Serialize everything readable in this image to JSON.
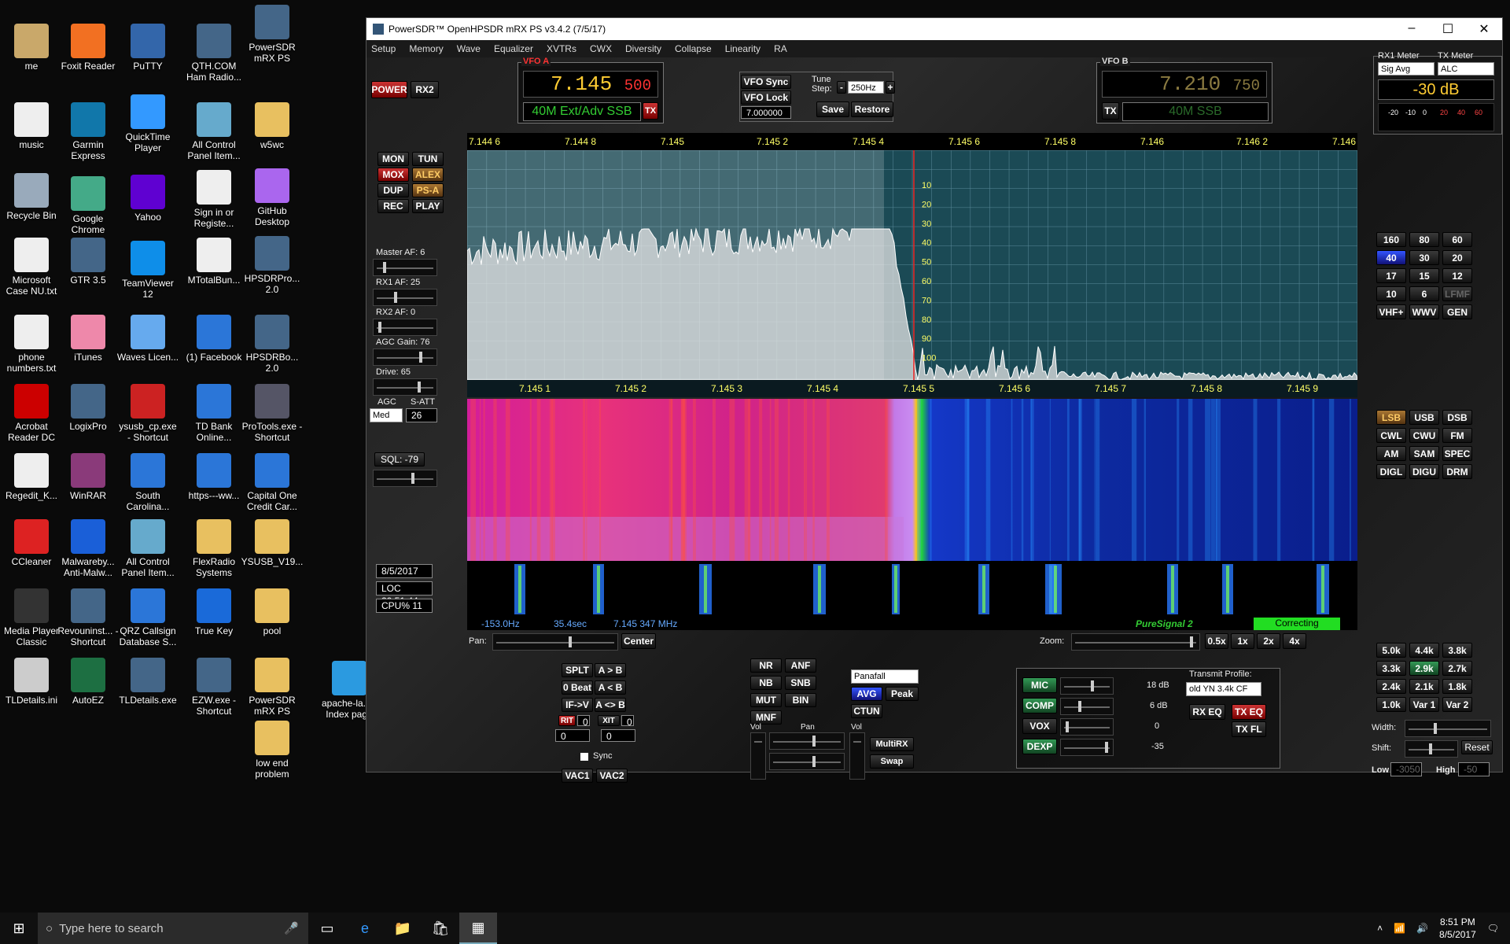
{
  "desktop": {
    "icons": [
      {
        "label": "me",
        "icon": "folder-user-icon"
      },
      {
        "label": "Foxit Reader",
        "icon": "pdf-icon"
      },
      {
        "label": "PuTTY",
        "icon": "terminal-icon"
      },
      {
        "label": "QTH.COM Ham Radio...",
        "icon": "app-icon"
      },
      {
        "label": "PowerSDR mRX PS",
        "icon": "app-icon"
      },
      {
        "label": "music",
        "icon": "file-icon"
      },
      {
        "label": "Garmin Express",
        "icon": "globe-icon"
      },
      {
        "label": "QuickTime Player",
        "icon": "quicktime-icon"
      },
      {
        "label": "All Control Panel Item...",
        "icon": "control-panel-icon"
      },
      {
        "label": "w5wc",
        "icon": "folder-icon"
      },
      {
        "label": "Recycle Bin",
        "icon": "recycle-bin-icon"
      },
      {
        "label": "Google Chrome",
        "icon": "chrome-icon"
      },
      {
        "label": "Yahoo",
        "icon": "yahoo-icon"
      },
      {
        "label": "Sign in or Registe...",
        "icon": "file-icon"
      },
      {
        "label": "GitHub Desktop",
        "icon": "github-icon"
      },
      {
        "label": "Microsoft Case NU.txt",
        "icon": "text-file-icon"
      },
      {
        "label": "GTR 3.5",
        "icon": "app-icon"
      },
      {
        "label": "TeamViewer 12",
        "icon": "teamviewer-icon"
      },
      {
        "label": "MTotalBun...",
        "icon": "file-icon"
      },
      {
        "label": "HPSDRPro... 2.0",
        "icon": "app-icon"
      },
      {
        "label": "phone numbers.txt",
        "icon": "text-file-icon"
      },
      {
        "label": "iTunes",
        "icon": "itunes-icon"
      },
      {
        "label": "Waves Licen...",
        "icon": "waves-icon"
      },
      {
        "label": "(1) Facebook",
        "icon": "edge-icon"
      },
      {
        "label": "HPSDRBo... 2.0",
        "icon": "app-icon"
      },
      {
        "label": "Acrobat Reader DC",
        "icon": "acrobat-icon"
      },
      {
        "label": "LogixPro",
        "icon": "app-icon"
      },
      {
        "label": "ysusb_cp.exe - Shortcut",
        "icon": "usb-icon"
      },
      {
        "label": "TD Bank Online...",
        "icon": "edge-icon"
      },
      {
        "label": "ProTools.exe - Shortcut",
        "icon": "protools-icon"
      },
      {
        "label": "Regedit_K...",
        "icon": "file-icon"
      },
      {
        "label": "WinRAR",
        "icon": "winrar-icon"
      },
      {
        "label": "South Carolina...",
        "icon": "edge-icon"
      },
      {
        "label": "https---ww...",
        "icon": "edge-icon"
      },
      {
        "label": "Capital One Credit Car...",
        "icon": "edge-icon"
      },
      {
        "label": "CCleaner",
        "icon": "ccleaner-icon"
      },
      {
        "label": "Malwareby... Anti-Malw...",
        "icon": "malwarebytes-icon"
      },
      {
        "label": "All Control Panel Item...",
        "icon": "control-panel-icon"
      },
      {
        "label": "FlexRadio Systems",
        "icon": "folder-icon"
      },
      {
        "label": "YSUSB_V19...",
        "icon": "folder-icon"
      },
      {
        "label": "Media Player Classic",
        "icon": "media-player-icon"
      },
      {
        "label": "Revouninst... - Shortcut",
        "icon": "app-icon"
      },
      {
        "label": "QRZ Callsign Database S...",
        "icon": "edge-icon"
      },
      {
        "label": "True Key",
        "icon": "truekey-icon"
      },
      {
        "label": "pool",
        "icon": "folder-icon"
      },
      {
        "label": "TLDetails.ini",
        "icon": "settings-file-icon"
      },
      {
        "label": "AutoEZ",
        "icon": "excel-icon"
      },
      {
        "label": "TLDetails.exe",
        "icon": "app-icon"
      },
      {
        "label": "EZW.exe - Shortcut",
        "icon": "app-icon"
      },
      {
        "label": "PowerSDR mRX PS",
        "icon": "folder-icon"
      },
      {
        "label": "apache-la... - Index page",
        "icon": "ie-icon"
      },
      {
        "label": "low end problem",
        "icon": "folder-icon"
      }
    ]
  },
  "taskbar": {
    "search_placeholder": "Type here to search",
    "time": "8:51 PM",
    "date": "8/5/2017"
  },
  "window": {
    "title": "PowerSDR™ OpenHPSDR mRX PS v3.4.2 (7/5/17)",
    "menu": [
      "Setup",
      "Memory",
      "Wave",
      "Equalizer",
      "XVTRs",
      "CWX",
      "Diversity",
      "Collapse",
      "Linearity",
      "RA"
    ]
  },
  "radio": {
    "power": "POWER",
    "rx2": "RX2",
    "vfo_a": {
      "title": "VFO A",
      "freq_main": "7.145",
      "freq_sub": "500",
      "mode": "40M Ext/Adv SSB",
      "tx": "TX"
    },
    "vfo_b": {
      "title": "VFO B",
      "freq_main": "7.210",
      "freq_sub": "750",
      "mode": "40M SSB",
      "tx": "TX"
    },
    "vfo_sync": "VFO Sync",
    "vfo_lock": "VFO Lock",
    "tune_step_label": "Tune Step:",
    "tune_step": "250Hz",
    "tune_minus": "-",
    "tune_plus": "+",
    "step_value": "7.000000",
    "save": "Save",
    "restore": "Restore",
    "meters": {
      "rx1": "RX1 Meter",
      "tx": "TX Meter",
      "rx1_sel": "Sig Avg",
      "tx_sel": "ALC",
      "reading": "-30 dB",
      "scale": [
        "-20",
        "-10",
        "0",
        "20",
        "40",
        "60"
      ]
    },
    "left_buttons": [
      "MON",
      "TUN",
      "MOX",
      "ALEX",
      "DUP",
      "PS-A",
      "REC",
      "PLAY"
    ],
    "master_af": "Master AF:  6",
    "rx1_af": "RX1 AF:  25",
    "rx2_af": "RX2 AF:  0",
    "agc_gain": "AGC Gain:  76",
    "drive": "Drive:  65",
    "agc_label": "AGC",
    "satt_label": "S-ATT",
    "agc_value": "Med",
    "satt_value": "26",
    "sql": "SQL:  -79",
    "date": "8/5/2017",
    "loc": "LOC 20:51:44",
    "cpu": "CPU%  11",
    "top_scale": [
      "7.144 6",
      "7.144 8",
      "7.145",
      "7.145 2",
      "7.145 4",
      "7.145 6",
      "7.145 8",
      "7.146",
      "7.146 2",
      "7.146"
    ],
    "db_scale": [
      "10",
      "20",
      "30",
      "40",
      "50",
      "60",
      "70",
      "80",
      "90",
      "100"
    ],
    "bottom_scale": [
      "7.145 1",
      "7.145 2",
      "7.145 3",
      "7.145 4",
      "7.145 5",
      "7.145 6",
      "7.145 7",
      "7.145 8",
      "7.145 9"
    ],
    "status": {
      "offset": "-153.0Hz",
      "time": "35.4sec",
      "freq": "7.145 347 MHz",
      "puresignal": "PureSignal 2",
      "correcting": "Correcting"
    },
    "bands": [
      "160",
      "80",
      "60",
      "40",
      "30",
      "20",
      "17",
      "15",
      "12",
      "10",
      "6",
      "LFMF",
      "VHF+",
      "WWV",
      "GEN"
    ],
    "modes": [
      "LSB",
      "USB",
      "DSB",
      "CWL",
      "CWU",
      "FM",
      "AM",
      "SAM",
      "SPEC",
      "DIGL",
      "DIGU",
      "DRM"
    ],
    "filters": [
      "5.0k",
      "4.4k",
      "3.8k",
      "3.3k",
      "2.9k",
      "2.7k",
      "2.4k",
      "2.1k",
      "1.8k",
      "1.0k",
      "Var 1",
      "Var 2"
    ],
    "width_label": "Width:",
    "shift_label": "Shift:",
    "reset": "Reset",
    "low_label": "Low",
    "high_label": "High",
    "low_value": "-3050",
    "high_value": "-50",
    "pan_label": "Pan:",
    "center": "Center",
    "zoom_label": "Zoom:",
    "zoom_buttons": [
      "0.5x",
      "1x",
      "2x",
      "4x"
    ],
    "split_block": [
      "SPLT",
      "A > B",
      "0 Beat",
      "A < B",
      "IF->V",
      "A <> B"
    ],
    "rit": "RIT",
    "rit_val": "0",
    "xit": "XIT",
    "xit_val": "0",
    "rit_num": "0",
    "xit_num": "0",
    "sync": "Sync",
    "vac1": "VAC1",
    "vac2": "VAC2",
    "dsp": [
      "NR",
      "ANF",
      "NB",
      "SNB",
      "MUT",
      "BIN",
      "MNF"
    ],
    "display_mode": "Panafall",
    "avg": "AVG",
    "peak": "Peak",
    "ctun": "CTUN",
    "vol": "Vol",
    "pan_small": "Pan",
    "vol2": "Vol",
    "multirx": "MultiRX",
    "swap": "Swap",
    "mic": "MIC",
    "mic_val": "18 dB",
    "comp": "COMP",
    "comp_val": "6 dB",
    "vox": "VOX",
    "vox_val": "0",
    "dexp": "DEXP",
    "dexp_val": "-35",
    "tx_profile_label": "Transmit Profile:",
    "tx_profile": "old YN 3.4k CF",
    "rx_eq": "RX EQ",
    "tx_eq": "TX EQ",
    "tx_fl": "TX FL"
  },
  "colors": {
    "accent_red": "#cc2222",
    "vfo_a_freq": "#ffcc33",
    "vfo_b_freq": "#8a7a40",
    "mode_green": "#33cc33",
    "status_blue": "#66aaff"
  }
}
